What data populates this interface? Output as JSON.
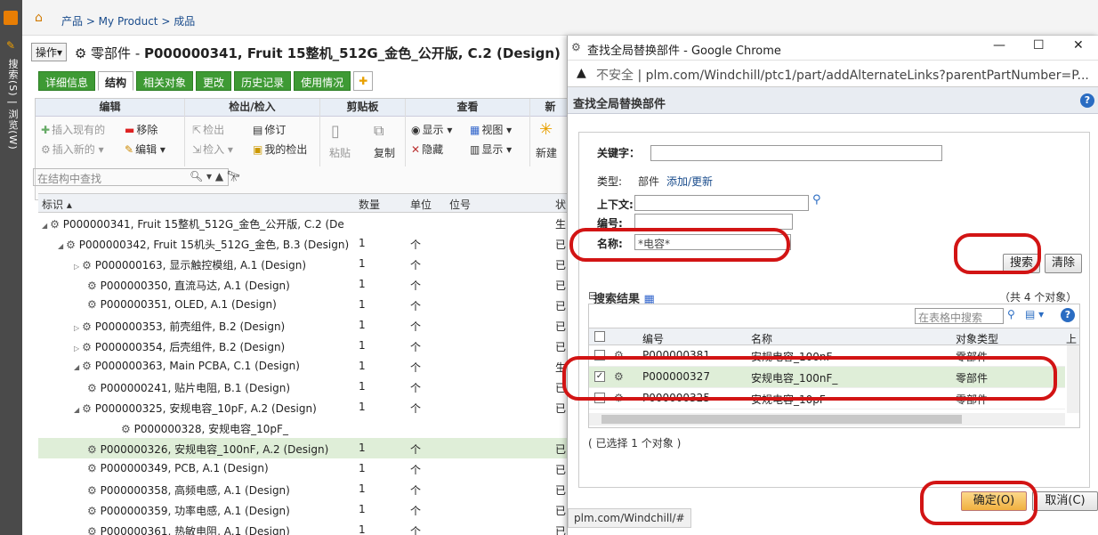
{
  "sidebar": {
    "vertical_text": "搜索(S) | 浏览(W)"
  },
  "breadcrumb": {
    "path": "产品 > My Product > 成品"
  },
  "page": {
    "ops_button": "操作▾",
    "type_label": "零部件 - ",
    "title": "P000000341, Fruit 15整机_512G_金色_公开版, C.2 (Design)"
  },
  "tabs": [
    {
      "label": "详细信息"
    },
    {
      "label": "结构"
    },
    {
      "label": "相关对象"
    },
    {
      "label": "更改"
    },
    {
      "label": "历史记录"
    },
    {
      "label": "使用情况"
    }
  ],
  "toolbar": {
    "groups": [
      "编辑",
      "检出/检入",
      "剪贴板",
      "查看",
      "新"
    ],
    "insert_existing": "插入现有的",
    "remove": "移除",
    "insert_new": "插入新的",
    "edit": "编辑",
    "checkout": "检出",
    "revise": "修订",
    "checkin": "检入",
    "my_checkouts": "我的检出",
    "paste": "粘贴",
    "copy": "复制",
    "show": "显示",
    "view": "视图",
    "hide": "隐藏",
    "display": "显示",
    "new": "新建"
  },
  "find": {
    "placeholder": "在结构中查找"
  },
  "grid": {
    "headers": [
      "标识",
      "数量",
      "单位",
      "位号",
      "状"
    ],
    "rows": [
      {
        "id": "P000000341, Fruit 15整机_512G_金色_公开版, C.2 (Design",
        "qty": "",
        "unit": "",
        "status": "生"
      },
      {
        "id": "P000000342, Fruit 15机头_512G_金色, B.3 (Design)",
        "qty": "1",
        "unit": "个",
        "status": "已"
      },
      {
        "id": "P000000163, 显示触控模组, A.1 (Design)",
        "qty": "1",
        "unit": "个",
        "status": "已"
      },
      {
        "id": "P000000350, 直流马达, A.1 (Design)",
        "qty": "1",
        "unit": "个",
        "status": "已"
      },
      {
        "id": "P000000351, OLED, A.1 (Design)",
        "qty": "1",
        "unit": "个",
        "status": "已"
      },
      {
        "id": "P000000353, 前壳组件, B.2 (Design)",
        "qty": "1",
        "unit": "个",
        "status": "已"
      },
      {
        "id": "P000000354, 后壳组件, B.2 (Design)",
        "qty": "1",
        "unit": "个",
        "status": "已"
      },
      {
        "id": "P000000363, Main PCBA, C.1 (Design)",
        "qty": "1",
        "unit": "个",
        "status": "生"
      },
      {
        "id": "P000000241, 贴片电阻, B.1 (Design)",
        "qty": "1",
        "unit": "个",
        "status": "已"
      },
      {
        "id": "P000000325, 安规电容_10pF, A.2 (Design)",
        "qty": "1",
        "unit": "个",
        "status": "已"
      },
      {
        "id": "P000000328, 安规电容_10pF_",
        "qty": "",
        "unit": "",
        "status": ""
      },
      {
        "id": "P000000326, 安规电容_100nF, A.2 (Design)",
        "qty": "1",
        "unit": "个",
        "status": "已"
      },
      {
        "id": "P000000349, PCB, A.1 (Design)",
        "qty": "1",
        "unit": "个",
        "status": "已"
      },
      {
        "id": "P000000358, 高频电感, A.1 (Design)",
        "qty": "1",
        "unit": "个",
        "status": "已"
      },
      {
        "id": "P000000359, 功率电感, A.1 (Design)",
        "qty": "1",
        "unit": "个",
        "status": "已"
      },
      {
        "id": "P000000361, 热敏电阻, A.1 (Design)",
        "qty": "1",
        "unit": "个",
        "status": "已"
      }
    ]
  },
  "popup": {
    "window_title": "查找全局替换部件 - Google Chrome",
    "insecure": "不安全",
    "url": "plm.com/Windchill/ptc1/part/addAlternateLinks?parentPartNumber=P...",
    "header": "查找全局替换部件",
    "keyword_label": "关键字：",
    "type_label": "类型:",
    "type_value": "部件",
    "type_link": "添加/更新",
    "context_label": "上下文:",
    "number_label": "编号:",
    "name_label": "名称:",
    "name_value": "*电容*",
    "search_btn": "搜索",
    "clear_btn": "清除",
    "results_title": "搜索结果",
    "results_count": "（共 4 个对象）",
    "table_search_placeholder": "在表格中搜索",
    "result_headers": [
      "编号",
      "名称",
      "对象类型",
      "上"
    ],
    "results": [
      {
        "number": "P000000381",
        "name": "安规电容_100nF",
        "type": "零部件",
        "checked": ""
      },
      {
        "number": "P000000327",
        "name": "安规电容_100nF_",
        "type": "零部件",
        "checked": "✓"
      },
      {
        "number": "P000000325",
        "name": "安规电容_10pF",
        "type": "零部件",
        "checked": ""
      }
    ],
    "selected_text": "( 已选择 1 个对象 )",
    "ok_btn": "确定(O)",
    "cancel_btn": "取消(C)",
    "status_url": "plm.com/Windchill/#"
  }
}
